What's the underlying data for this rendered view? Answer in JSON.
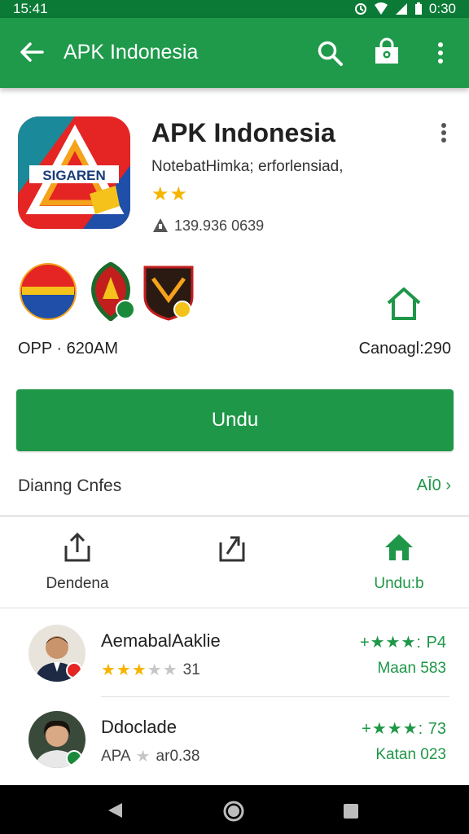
{
  "status": {
    "left": "15:41",
    "time": "0:30"
  },
  "appbar": {
    "title": "APK Indonesia"
  },
  "app": {
    "icon_text": "SIGAREN",
    "title": "APK Indonesia",
    "subtitle": "NotebatHimka; erforlensiad,",
    "stars": "★★",
    "downloads": "139.936 0639"
  },
  "info": {
    "left": "OPP · 620AM",
    "right": "Canoagl:290"
  },
  "install": {
    "label": "Undu"
  },
  "section": {
    "label": "Dianng Cnfes",
    "more": "AĪ0"
  },
  "actions": [
    {
      "label": "Dendena"
    },
    {
      "label": ""
    },
    {
      "label": "Undu:b"
    }
  ],
  "reviews": [
    {
      "name": "AemabalAaklie",
      "stars_filled": "★★★",
      "stars_empty": "★★",
      "count": "31",
      "score_stars": "+★★★:",
      "score": "P4",
      "meta": "Maan 583"
    },
    {
      "name": "Ddoclade",
      "stars_filled": "APA",
      "stars_empty": "★",
      "count": "ar0.38",
      "score_stars": "+★★★:",
      "score": "73",
      "meta": "Katan 023"
    }
  ],
  "colors": {
    "primary": "#1f9a4b",
    "status": "#0b7a36",
    "accent": "#1e9748",
    "star": "#f6b400"
  }
}
